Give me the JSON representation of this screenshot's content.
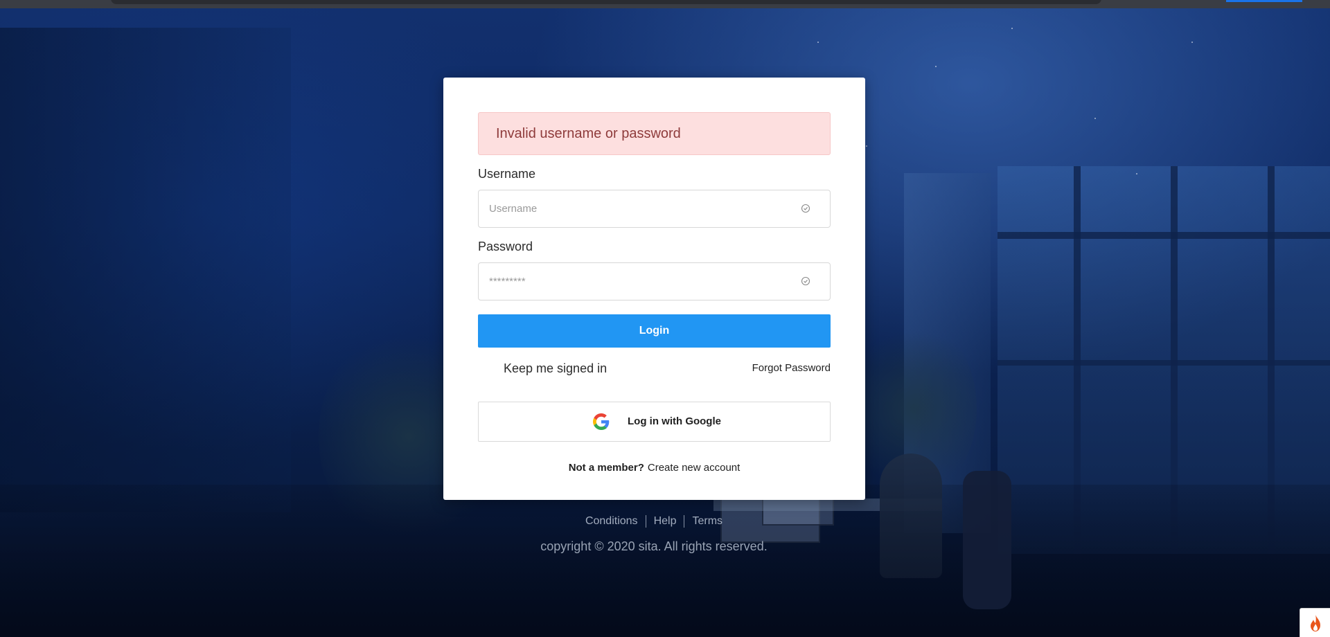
{
  "alert": {
    "message": "Invalid username or password"
  },
  "form": {
    "username_label": "Username",
    "username_placeholder": "Username",
    "username_value": "",
    "password_label": "Password",
    "password_placeholder": "*********",
    "password_value": "",
    "login_label": "Login",
    "keep_signed_in_label": "Keep me signed in",
    "forgot_password_label": "Forgot Password",
    "google_login_label": "Log in with Google",
    "not_member_text": "Not a member?",
    "create_account_label": "Create new account"
  },
  "footer": {
    "links": [
      "Conditions",
      "Help",
      "Terms"
    ],
    "copyright": "copyright © 2020 sita. All rights reserved."
  },
  "icons": {
    "field_check": "check-circle-icon",
    "google": "google-icon",
    "corner": "fire-icon"
  },
  "colors": {
    "login_button": "#2196f3",
    "alert_bg": "#fddfdf",
    "alert_text": "#8e3b3b"
  }
}
